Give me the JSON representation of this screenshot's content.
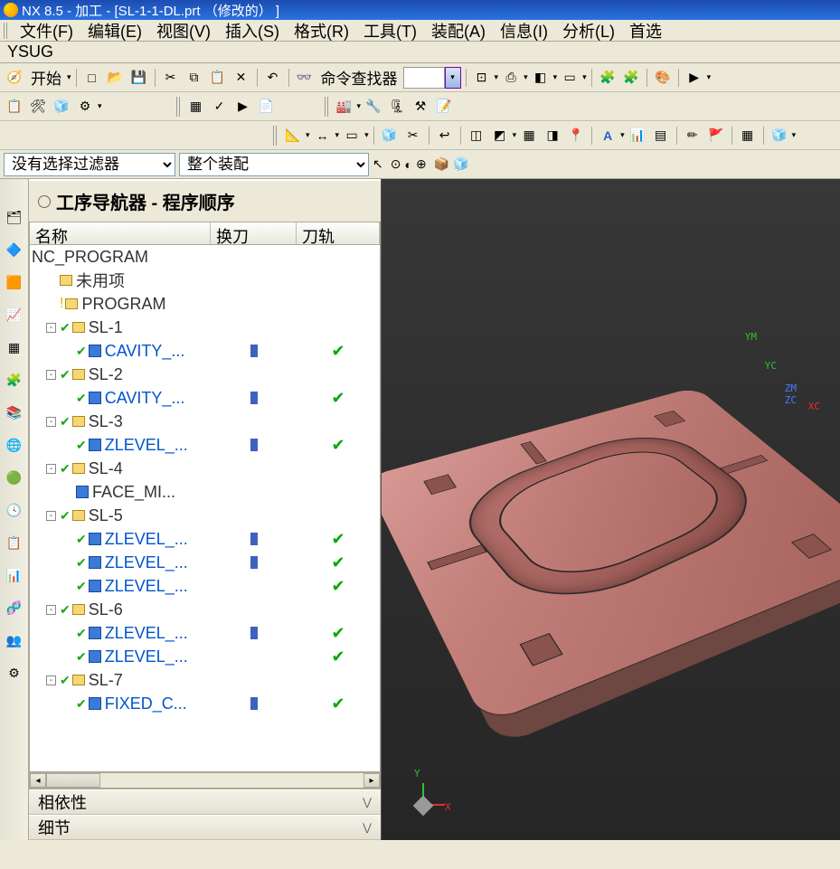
{
  "title": "NX 8.5 - 加工 - [SL-1-1-DL.prt （修改的） ]",
  "menubar": [
    "文件(F)",
    "编辑(E)",
    "视图(V)",
    "插入(S)",
    "格式(R)",
    "工具(T)",
    "装配(A)",
    "信息(I)",
    "分析(L)",
    "首选"
  ],
  "ysug": "YSUG",
  "start_label": "开始",
  "cmd_finder_label": "命令查找器",
  "filter_no_sel": "没有选择过滤器",
  "filter_asm": "整个装配",
  "nav_title": "工序导航器 - 程序顺序",
  "columns": {
    "name": "名称",
    "tool": "换刀",
    "path": "刀轨"
  },
  "tree": [
    {
      "indent": 0,
      "exp": "",
      "chk": false,
      "icon": "",
      "text": "NC_PROGRAM",
      "link": false,
      "tool": "",
      "path": ""
    },
    {
      "indent": 1,
      "exp": "",
      "chk": false,
      "icon": "folder",
      "text": "未用项",
      "link": false,
      "tool": "",
      "path": ""
    },
    {
      "indent": 1,
      "exp": "",
      "chk": false,
      "icon": "folder",
      "warn": true,
      "text": "PROGRAM",
      "link": false,
      "tool": "",
      "path": ""
    },
    {
      "indent": 1,
      "exp": "-",
      "chk": true,
      "icon": "folder",
      "text": "SL-1",
      "link": false,
      "tool": "",
      "path": ""
    },
    {
      "indent": 2,
      "exp": "",
      "chk": true,
      "icon": "op",
      "text": "CAVITY_...",
      "link": true,
      "tool": "y",
      "path": "✔"
    },
    {
      "indent": 1,
      "exp": "-",
      "chk": true,
      "icon": "folder",
      "text": "SL-2",
      "link": false,
      "tool": "",
      "path": ""
    },
    {
      "indent": 2,
      "exp": "",
      "chk": true,
      "icon": "op",
      "text": "CAVITY_...",
      "link": true,
      "tool": "y",
      "path": "✔"
    },
    {
      "indent": 1,
      "exp": "-",
      "chk": true,
      "icon": "folder",
      "text": "SL-3",
      "link": false,
      "tool": "",
      "path": ""
    },
    {
      "indent": 2,
      "exp": "",
      "chk": true,
      "icon": "op",
      "text": "ZLEVEL_...",
      "link": true,
      "tool": "y",
      "path": "✔"
    },
    {
      "indent": 1,
      "exp": "-",
      "chk": true,
      "icon": "folder",
      "text": "SL-4",
      "link": false,
      "tool": "",
      "path": ""
    },
    {
      "indent": 2,
      "exp": "",
      "chk": false,
      "icon": "op",
      "text": "FACE_MI...",
      "link": false,
      "tool": "",
      "path": ""
    },
    {
      "indent": 1,
      "exp": "-",
      "chk": true,
      "icon": "folder",
      "text": "SL-5",
      "link": false,
      "tool": "",
      "path": ""
    },
    {
      "indent": 2,
      "exp": "",
      "chk": true,
      "icon": "op",
      "text": "ZLEVEL_...",
      "link": true,
      "tool": "y",
      "path": "✔"
    },
    {
      "indent": 2,
      "exp": "",
      "chk": true,
      "icon": "op",
      "text": "ZLEVEL_...",
      "link": true,
      "tool": "y",
      "path": "✔"
    },
    {
      "indent": 2,
      "exp": "",
      "chk": true,
      "icon": "op",
      "text": "ZLEVEL_...",
      "link": true,
      "tool": "",
      "path": "✔"
    },
    {
      "indent": 1,
      "exp": "-",
      "chk": true,
      "icon": "folder",
      "text": "SL-6",
      "link": false,
      "tool": "",
      "path": ""
    },
    {
      "indent": 2,
      "exp": "",
      "chk": true,
      "icon": "op",
      "text": "ZLEVEL_...",
      "link": true,
      "tool": "y",
      "path": "✔"
    },
    {
      "indent": 2,
      "exp": "",
      "chk": true,
      "icon": "op",
      "text": "ZLEVEL_...",
      "link": true,
      "tool": "",
      "path": "✔"
    },
    {
      "indent": 1,
      "exp": "-",
      "chk": true,
      "icon": "folder",
      "text": "SL-7",
      "link": false,
      "tool": "",
      "path": ""
    },
    {
      "indent": 2,
      "exp": "",
      "chk": true,
      "icon": "op",
      "text": "FIXED_C...",
      "link": true,
      "tool": "y",
      "path": "✔"
    }
  ],
  "accordion": {
    "deps": "相依性",
    "details": "细节"
  },
  "axes": {
    "xc": "XC",
    "yc": "YC",
    "zm": "ZM",
    "zc": "ZC",
    "ym": "YM",
    "x": "X",
    "y": "Y"
  },
  "icons": {
    "new": "□",
    "open": "📂",
    "save": "💾",
    "cut": "✂",
    "copy": "⧉",
    "paste": "📋",
    "delete": "✕",
    "undo": "↶",
    "glasses": "👓",
    "dd": "▾",
    "cube": "◧",
    "printer": "⎙",
    "ruler": "◫",
    "snap": "⌖",
    "layers": "≣"
  }
}
